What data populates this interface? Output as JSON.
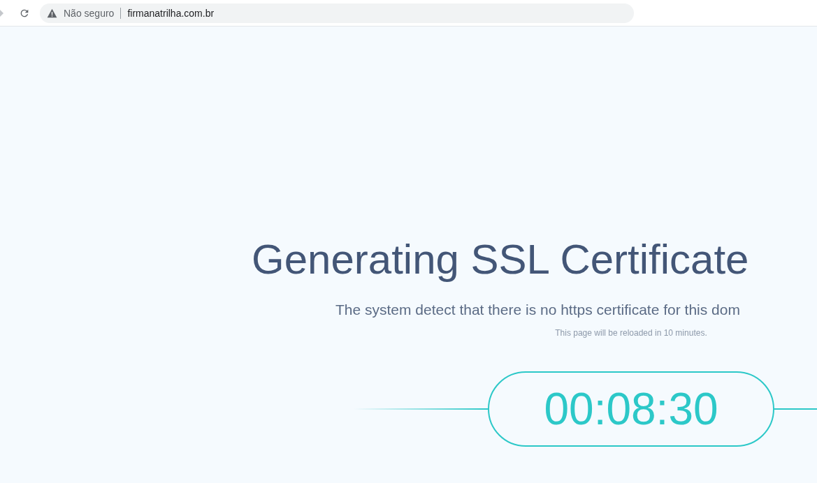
{
  "browser": {
    "security_label": "Não seguro",
    "url": "firmanatrilha.com.br"
  },
  "page": {
    "title": "Generating SSL Certificate",
    "message": "The system detect that there is no https certificate for this dom",
    "note": "This page will be reloaded in 10 minutes.",
    "countdown": "00:08:30"
  }
}
